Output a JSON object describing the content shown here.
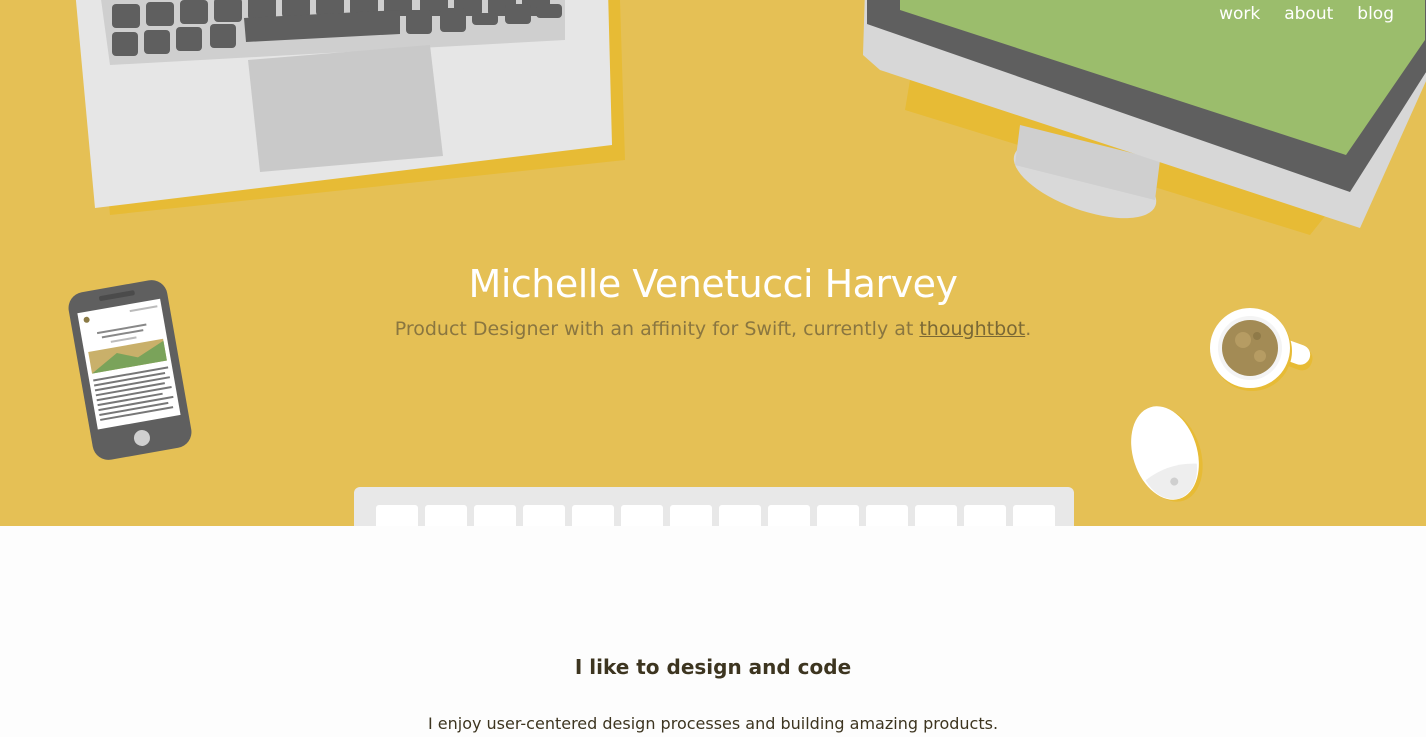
{
  "nav": {
    "items": [
      {
        "label": "work"
      },
      {
        "label": "about"
      },
      {
        "label": "blog"
      }
    ]
  },
  "hero": {
    "title": "Michelle Venetucci Harvey",
    "subtitle_prefix": "Product Designer with an affinity for Swift, currently at ",
    "subtitle_link": "thoughtbot",
    "subtitle_suffix": "."
  },
  "section": {
    "heading": "I like to design and code",
    "body": "I enjoy user-centered design processes and building amazing products."
  },
  "colors": {
    "hero_bg": "#e5c055",
    "text_dark": "#3d3520",
    "subtitle": "#8a7640"
  },
  "icons": {
    "laptop": "laptop-icon",
    "monitor": "monitor-icon",
    "phone": "phone-icon",
    "coffee": "coffee-cup-icon",
    "mouse": "mouse-icon",
    "keyboard": "keyboard-icon"
  }
}
